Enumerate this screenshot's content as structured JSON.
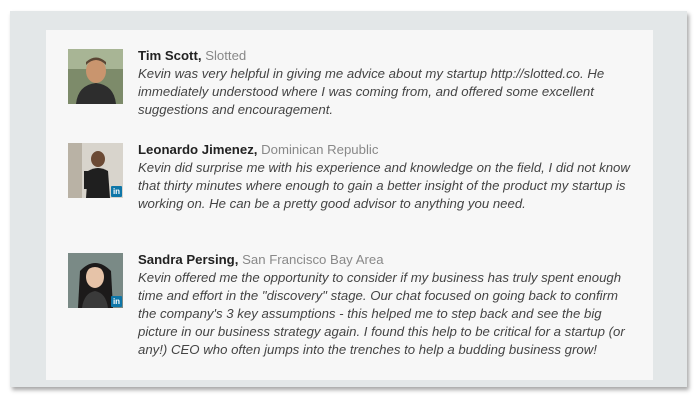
{
  "testimonials": [
    {
      "name": "Tim Scott",
      "org": "Slotted",
      "quote": "Kevin was very helpful in giving me advice about my startup http://slotted.co. He immediately understood where I was coming from, and offered some excellent suggestions and encouragement.",
      "linkedin_badge": ""
    },
    {
      "name": "Leonardo Jimenez",
      "org": "Dominican Republic",
      "quote": "Kevin did surprise me with his experience and knowledge on the field, I did not know that thirty minutes where enough to gain a better insight of the product my startup is working on. He can be a pretty good advisor to anything you need.",
      "linkedin_badge": "in"
    },
    {
      "name": "Sandra Persing",
      "org": "San Francisco Bay Area",
      "quote": "Kevin offered me the opportunity to consider if my business has truly spent enough time and effort in the \"discovery\" stage. Our chat focused on going back to confirm the company's 3 key assumptions - this helped me to step back and see the big picture in our business strategy again. I found this help to be critical for a startup (or any!) CEO who often jumps into the trenches to help a budding business grow!",
      "linkedin_badge": "in"
    }
  ],
  "separator": ","
}
